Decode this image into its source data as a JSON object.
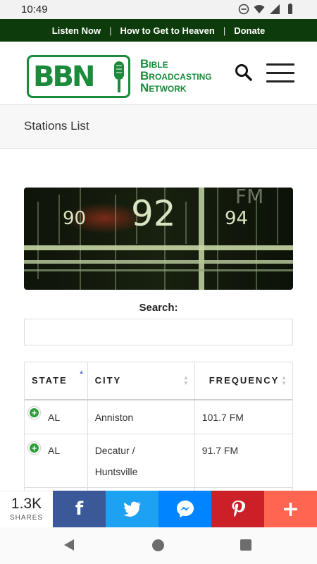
{
  "status_bar": {
    "time": "10:49"
  },
  "top_nav": {
    "items": [
      "Listen Now",
      "How to Get to Heaven",
      "Donate"
    ],
    "separator": "|"
  },
  "logo": {
    "letters": "BBN",
    "line1": "Bible",
    "line2": "Broadcasting",
    "line3": "Network",
    "brand_color": "#1b8a3b"
  },
  "page": {
    "title": "Stations List"
  },
  "banner": {
    "dial_labels": [
      "90",
      "92",
      "94"
    ],
    "band_label": "FM"
  },
  "search": {
    "label": "Search:",
    "value": ""
  },
  "table": {
    "headers": [
      "STATE",
      "CITY",
      "FREQUENCY"
    ],
    "rows": [
      {
        "state": "AL",
        "city": "Anniston",
        "frequency": "101.7 FM"
      },
      {
        "state": "AL",
        "city": "Decatur /",
        "city2": "Huntsville",
        "frequency": "91.7 FM"
      }
    ]
  },
  "share_bar": {
    "count": "1.3K",
    "label": "SHARES",
    "buttons": [
      {
        "name": "facebook-icon",
        "glyph": "f",
        "color": "#3b5998"
      },
      {
        "name": "twitter-icon",
        "color": "#1da1f2"
      },
      {
        "name": "messenger-icon",
        "color": "#0084ff"
      },
      {
        "name": "pinterest-icon",
        "color": "#cb2027"
      },
      {
        "name": "plus-icon",
        "glyph": "+",
        "color": "#ff6550"
      }
    ]
  }
}
